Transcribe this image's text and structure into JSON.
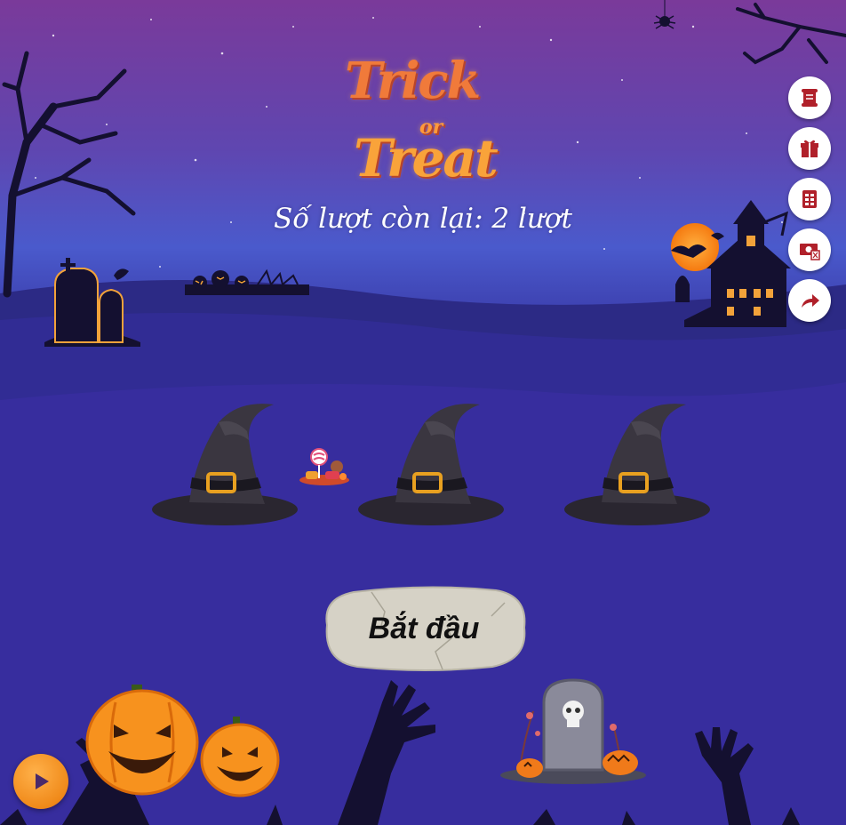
{
  "game": {
    "logo": {
      "line1": "Trick",
      "line2": "or",
      "line3": "Treat"
    },
    "turns_remaining_text": "Số lượt còn lại: 2 lượt",
    "start_button_label": "Bắt đầu",
    "side_menu": [
      {
        "icon": "rules-scroll-icon"
      },
      {
        "icon": "gift-icon"
      },
      {
        "icon": "list-icon"
      },
      {
        "icon": "prize-ticket-icon"
      },
      {
        "icon": "share-icon"
      }
    ],
    "hats": [
      {
        "name": "hat-1"
      },
      {
        "name": "hat-2"
      },
      {
        "name": "hat-3"
      }
    ],
    "play_button_icon": "play-icon"
  },
  "colors": {
    "sky_top": "#7a3a9a",
    "sky_mid": "#4a5acc",
    "ground": "#2e2a8a",
    "logo_orange": "#f07a3a",
    "icon_red": "#b0202a",
    "play_orange": "#f08a1a"
  }
}
